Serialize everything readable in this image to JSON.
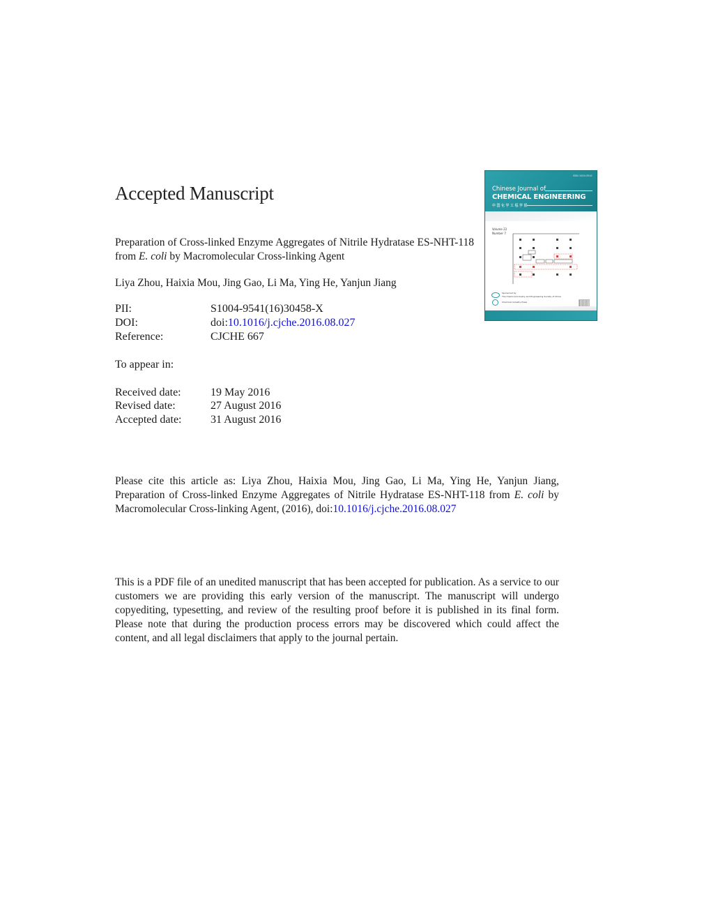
{
  "heading": "Accepted Manuscript",
  "article": {
    "title_part1": "Preparation of Cross-linked Enzyme Aggregates of Nitrile Hydratase ES-NHT-118 from ",
    "title_italic": "E. coli",
    "title_part2": " by Macromolecular Cross-linking Agent",
    "authors": "Liya Zhou, Haixia Mou, Jing Gao, Li Ma, Ying He, Yanjun Jiang"
  },
  "meta": {
    "pii_label": "PII:",
    "pii_value": "S1004-9541(16)30458-X",
    "doi_label": "DOI:",
    "doi_prefix": "doi:",
    "doi_value": "10.1016/j.cjche.2016.08.027",
    "reference_label": "Reference:",
    "reference_value": "CJCHE 667",
    "appear_label": "To appear in:",
    "received_label": "Received date:",
    "received_value": "19 May 2016",
    "revised_label": "Revised date:",
    "revised_value": "27 August 2016",
    "accepted_label": "Accepted date:",
    "accepted_value": "31 August 2016"
  },
  "citation": {
    "part1": "Please cite this article as:  Liya Zhou, Haixia Mou, Jing Gao, Li Ma, Ying He, Yanjun Jiang, Preparation of Cross-linked Enzyme Aggregates of Nitrile Hydratase ES-NHT-118 from ",
    "italic": "E. coli",
    "part2": " by Macromolecular Cross-linking Agent,  (2016), ",
    "doi_prefix": "doi:",
    "doi_value": "10.1016/j.cjche.2016.08.027"
  },
  "disclaimer": "This is a PDF file of an unedited manuscript that has been accepted for publication. As a service to our customers we are providing this early version of the manuscript. The manuscript will undergo copyediting, typesetting, and review of the resulting proof before it is published in its final form. Please note that during the production process errors may be discovered which could affect the content, and all legal disclaimers that apply to the journal pertain.",
  "cover": {
    "issn": "ISSN 1004-9541",
    "journal_line1": "Chinese Journal of",
    "journal_line2": "CHEMICAL ENGINEERING",
    "journal_line3": "中国化学工程学报",
    "volume": "Volume 22",
    "number": "Number 7",
    "sponsored_by": "Sponsored by",
    "sponsor1": "The Chemical Industry and Engineering Society of China",
    "sponsor2": "Chemical Industry Press",
    "colors": {
      "primary": "#1f8f9a",
      "accent_red": "#e0403a"
    }
  },
  "colors": {
    "link": "#1010dd",
    "text": "#1a1a1a"
  }
}
